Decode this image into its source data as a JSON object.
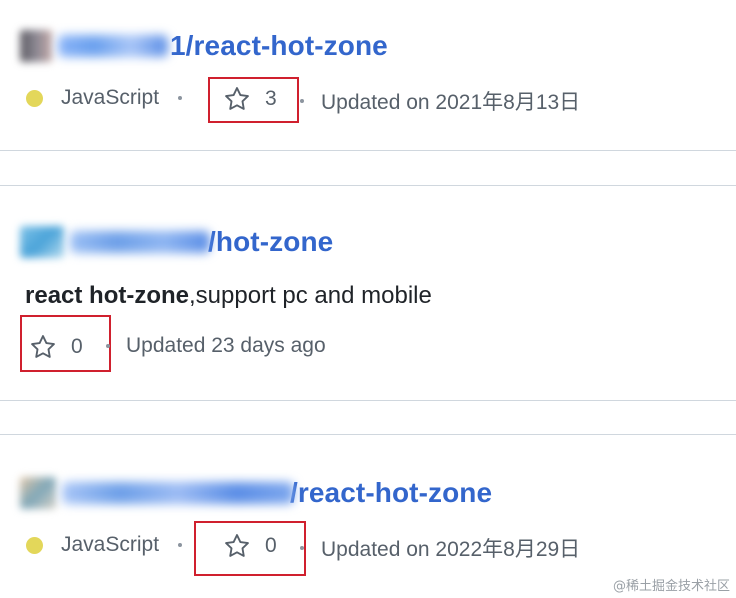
{
  "accent": "#3366cc",
  "highlight_color": "#d0202e",
  "repos": [
    {
      "repo_suffix": "1/react-hot-zone",
      "language": "JavaScript",
      "language_color": "#e3d75a",
      "stars": "3",
      "updated": "Updated on 2021年8月13日"
    },
    {
      "repo_suffix": "/hot-zone",
      "description_bold": "react hot-zone",
      "description_rest": ",support pc and mobile",
      "stars": "0",
      "updated": "Updated 23 days ago"
    },
    {
      "repo_suffix": "/react-hot-zone",
      "language": "JavaScript",
      "language_color": "#e3d75a",
      "stars": "0",
      "updated": "Updated on 2022年8月29日"
    }
  ],
  "watermark": "@稀土掘金技术社区",
  "icons": {
    "star": "star-icon"
  }
}
